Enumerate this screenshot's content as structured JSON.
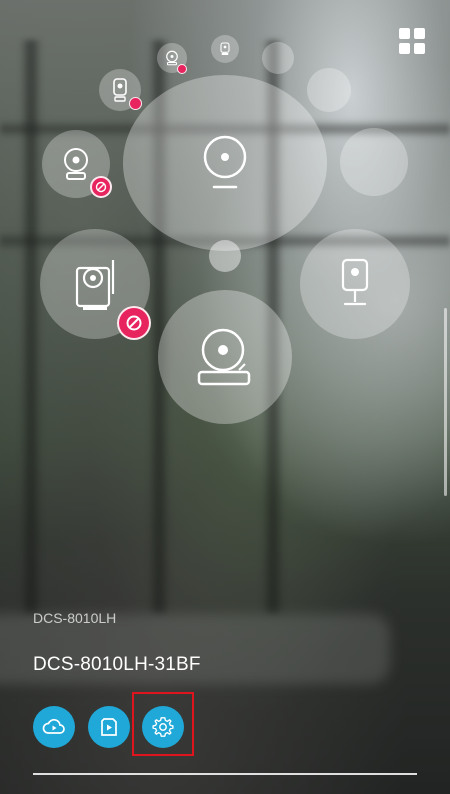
{
  "device": {
    "model": "DCS-8010LH",
    "name": "DCS-8010LH-31BF"
  },
  "actions": [
    {
      "name": "cloud-playback",
      "icon": "cloud-play-icon"
    },
    {
      "name": "local-playback",
      "icon": "sd-play-icon"
    },
    {
      "name": "settings",
      "icon": "gear-icon",
      "highlighted": true
    }
  ],
  "colors": {
    "accent": "#1fa8d8",
    "offline_badge": "#e8245f",
    "highlight_box": "#e0141c"
  }
}
